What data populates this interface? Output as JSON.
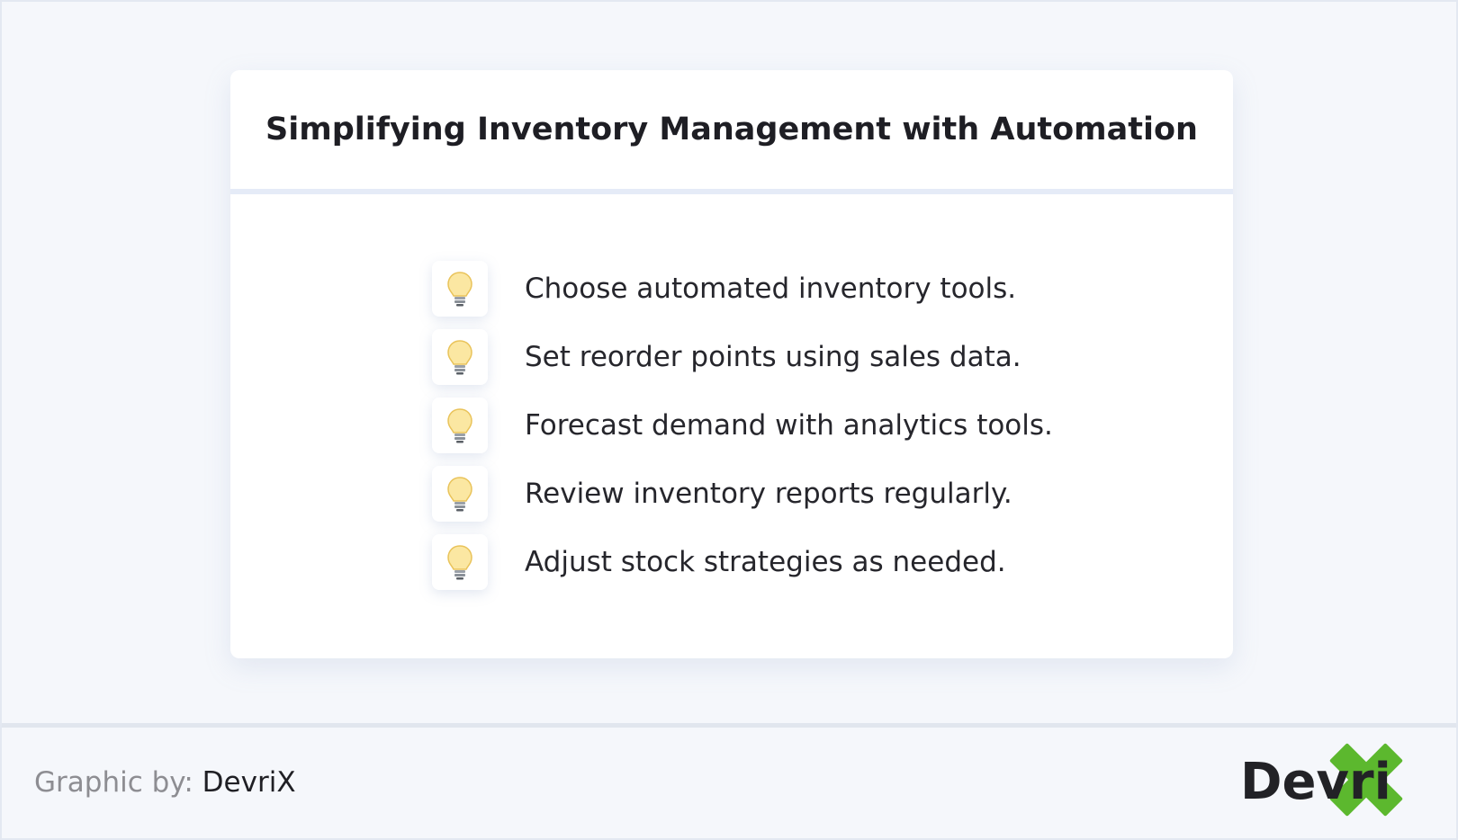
{
  "card": {
    "title": "Simplifying Inventory Management with Automation",
    "tips": [
      {
        "icon": "lightbulb-icon",
        "text": "Choose automated inventory tools."
      },
      {
        "icon": "lightbulb-icon",
        "text": "Set reorder points using sales data."
      },
      {
        "icon": "lightbulb-icon",
        "text": "Forecast demand with analytics tools."
      },
      {
        "icon": "lightbulb-icon",
        "text": "Review inventory reports regularly."
      },
      {
        "icon": "lightbulb-icon",
        "text": "Adjust stock strategies as needed."
      }
    ]
  },
  "footer": {
    "credit_label": "Graphic by:",
    "credit_brand": "DevriX",
    "logo_text": "DevriX"
  },
  "colors": {
    "background": "#f5f7fb",
    "card": "#ffffff",
    "divider": "#e5ebf7",
    "logo_dark": "#222226",
    "logo_green": "#5cb82e",
    "bulb_yellow": "#fbe7a2"
  }
}
